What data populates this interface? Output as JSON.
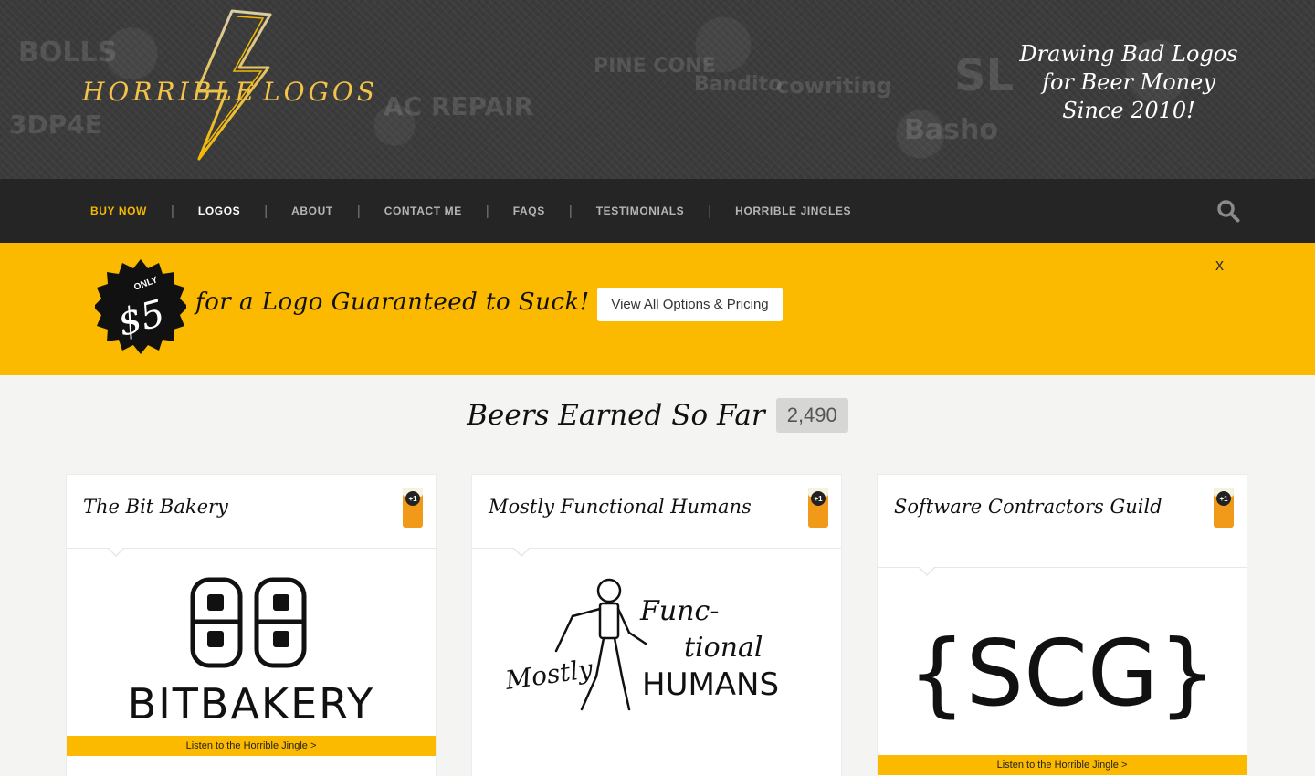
{
  "header": {
    "logo": {
      "left": "HORRIBLE",
      "right": "LOGOS"
    },
    "tagline": [
      "Drawing Bad Logos",
      "for Beer Money",
      "Since 2010!"
    ]
  },
  "nav": {
    "items": [
      {
        "label": "BUY NOW"
      },
      {
        "label": "LOGOS"
      },
      {
        "label": "ABOUT"
      },
      {
        "label": "CONTACT ME"
      },
      {
        "label": "FAQS"
      },
      {
        "label": "TESTIMONIALS"
      },
      {
        "label": "HORRIBLE JINGLES"
      }
    ],
    "search_icon": "search-icon"
  },
  "promo": {
    "badge_only": "ONLY",
    "badge_price": "$5",
    "text": "for a Logo Guaranteed to Suck!",
    "button_label": "View All Options & Pricing",
    "close_label": "x",
    "background": "#fbb900"
  },
  "beers": {
    "title": "Beers Earned So Far",
    "count": "2,490"
  },
  "cards": [
    {
      "title": "The Bit Bakery",
      "badge": "+1",
      "jingle": "Listen to the Horrible Jingle >",
      "art_top": "BB",
      "art_bottom": "BITBAKERY"
    },
    {
      "title": "Mostly Functional Humans",
      "badge": "+1",
      "art_left": "Mostly",
      "art_right1": "Func-",
      "art_right2": "tional",
      "art_right3": "HUMANS"
    },
    {
      "title": "Software Contractors Guild",
      "badge": "+1",
      "jingle": "Listen to the Horrible Jingle >",
      "art": "{SCG}"
    }
  ],
  "colors": {
    "accent": "#fbb900",
    "nav_bg": "#252525",
    "active_nav": "#f5b800"
  }
}
